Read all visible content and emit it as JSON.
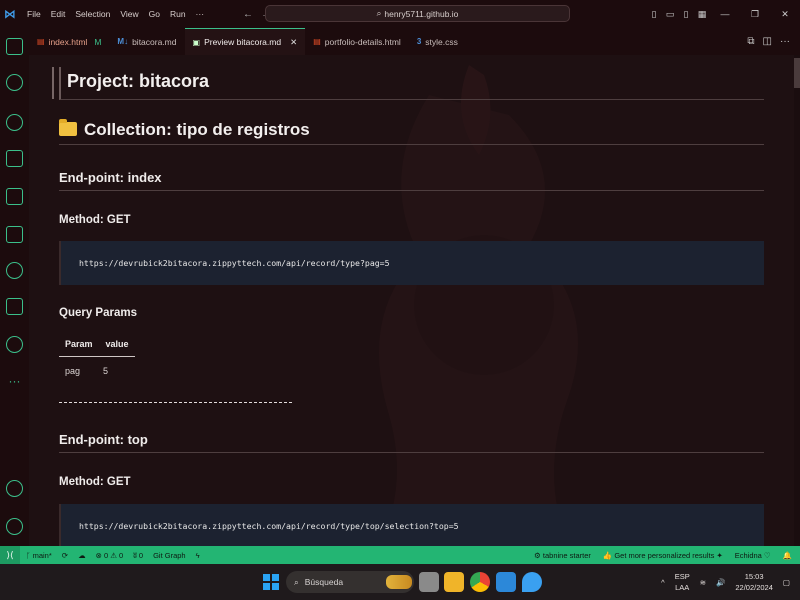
{
  "titlebar": {
    "menu": [
      "File",
      "Edit",
      "Selection",
      "View",
      "Go",
      "Run",
      "···"
    ],
    "search": "henry5711.github.io"
  },
  "tabs": [
    {
      "label": "index.html",
      "icon": "html-icon",
      "badge": "M",
      "icon_color": "#e44d26"
    },
    {
      "label": "bitacora.md",
      "icon": "markdown-icon",
      "icon_color": "#4c8fd8"
    },
    {
      "label": "Preview bitacora.md",
      "icon": "preview-icon",
      "active": true
    },
    {
      "label": "portfolio-details.html",
      "icon": "html-icon",
      "icon_color": "#e44d26"
    },
    {
      "label": "style.css",
      "icon": "css-icon",
      "icon_color": "#4c8fd8"
    }
  ],
  "markdown": {
    "project_title": "Project: bitacora",
    "collection_title": "Collection: tipo de registros",
    "endpoint1": {
      "title": "End-point: index",
      "method": "Method: GET",
      "url": "https://devrubick2bitacora.zippyttech.com/api/record/type?pag=5"
    },
    "query_params": {
      "title": "Query Params",
      "headers": [
        "Param",
        "value"
      ],
      "rows": [
        [
          "pag",
          "5"
        ]
      ]
    },
    "endpoint2": {
      "title": "End-point: top",
      "method": "Method: GET",
      "url": "https://devrubick2bitacora.zippyttech.com/api/record/type/top/selection?top=5"
    }
  },
  "statusbar": {
    "branch": "main*",
    "problems": "⊗ 0 ⚠ 0",
    "ports": "0",
    "graph": "Git Graph",
    "tabnine": "tabnine starter",
    "personalized": "Get more personalized results",
    "echidna": "Echidna"
  },
  "taskbar": {
    "search": "Búsqueda",
    "lang1": "ESP",
    "lang2": "LAA",
    "time": "15:03",
    "date": "22/02/2024"
  }
}
